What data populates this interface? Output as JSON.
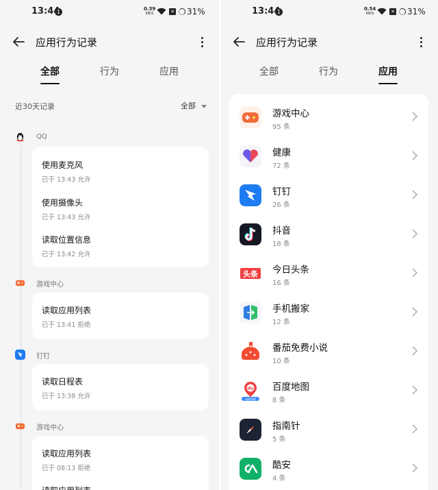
{
  "status_bar": {
    "time": "13:44",
    "notification": "1",
    "left_net_value": "0.39",
    "right_net_value": "0.54",
    "net_unit": "KB/S",
    "battery": "31%"
  },
  "header": {
    "title": "应用行为记录"
  },
  "tabs": [
    "全部",
    "行为",
    "应用"
  ],
  "left": {
    "active_tab": "全部",
    "range_label": "近30天记录",
    "filter_label": "全部",
    "groups": [
      {
        "app": "QQ",
        "icon": "qq-icon",
        "records": [
          {
            "action": "使用麦克风",
            "meta": "已于 13:43 允许"
          },
          {
            "action": "使用摄像头",
            "meta": "已于 13:43 允许"
          },
          {
            "action": "读取位置信息",
            "meta": "已于 13:42 允许"
          }
        ]
      },
      {
        "app": "游戏中心",
        "icon": "game-center-icon",
        "records": [
          {
            "action": "读取应用列表",
            "meta": "已于 13:41 拒绝"
          }
        ]
      },
      {
        "app": "钉钉",
        "icon": "dingtalk-icon",
        "records": [
          {
            "action": "读取日程表",
            "meta": "已于 13:38 允许"
          }
        ]
      },
      {
        "app": "游戏中心",
        "icon": "game-center-icon",
        "records": [
          {
            "action": "读取应用列表",
            "meta": "已于 08:13 拒绝"
          },
          {
            "action": "读取应用列表",
            "meta": ""
          }
        ]
      }
    ]
  },
  "right": {
    "active_tab": "应用",
    "apps": [
      {
        "name": "游戏中心",
        "count": "95 条",
        "icon": "game-center-icon",
        "color": "#f26b3a"
      },
      {
        "name": "健康",
        "count": "72 条",
        "icon": "health-heart-icon",
        "color": "#e8465a"
      },
      {
        "name": "钉钉",
        "count": "26 条",
        "icon": "dingtalk-icon",
        "color": "#1e7cf2"
      },
      {
        "name": "抖音",
        "count": "18 条",
        "icon": "douyin-icon",
        "color": "#161823"
      },
      {
        "name": "今日头条",
        "count": "16 条",
        "icon": "toutiao-icon",
        "color": "#f04142"
      },
      {
        "name": "手机搬家",
        "count": "12 条",
        "icon": "phone-clone-icon",
        "color": "#2f7de1"
      },
      {
        "name": "番茄免费小说",
        "count": "10 条",
        "icon": "tomato-novel-icon",
        "color": "#f24b32"
      },
      {
        "name": "百度地图",
        "count": "8 条",
        "icon": "baidu-map-icon",
        "color": "#3c8bfb"
      },
      {
        "name": "指南针",
        "count": "5 条",
        "icon": "compass-icon",
        "color": "#1c2333"
      },
      {
        "name": "酷安",
        "count": "4 条",
        "icon": "coolapk-icon",
        "color": "#11b067"
      }
    ]
  },
  "icon_badges": {
    "toutiao": "头条",
    "baidu_map": "du",
    "baidu_map_sub": "送你回家"
  }
}
